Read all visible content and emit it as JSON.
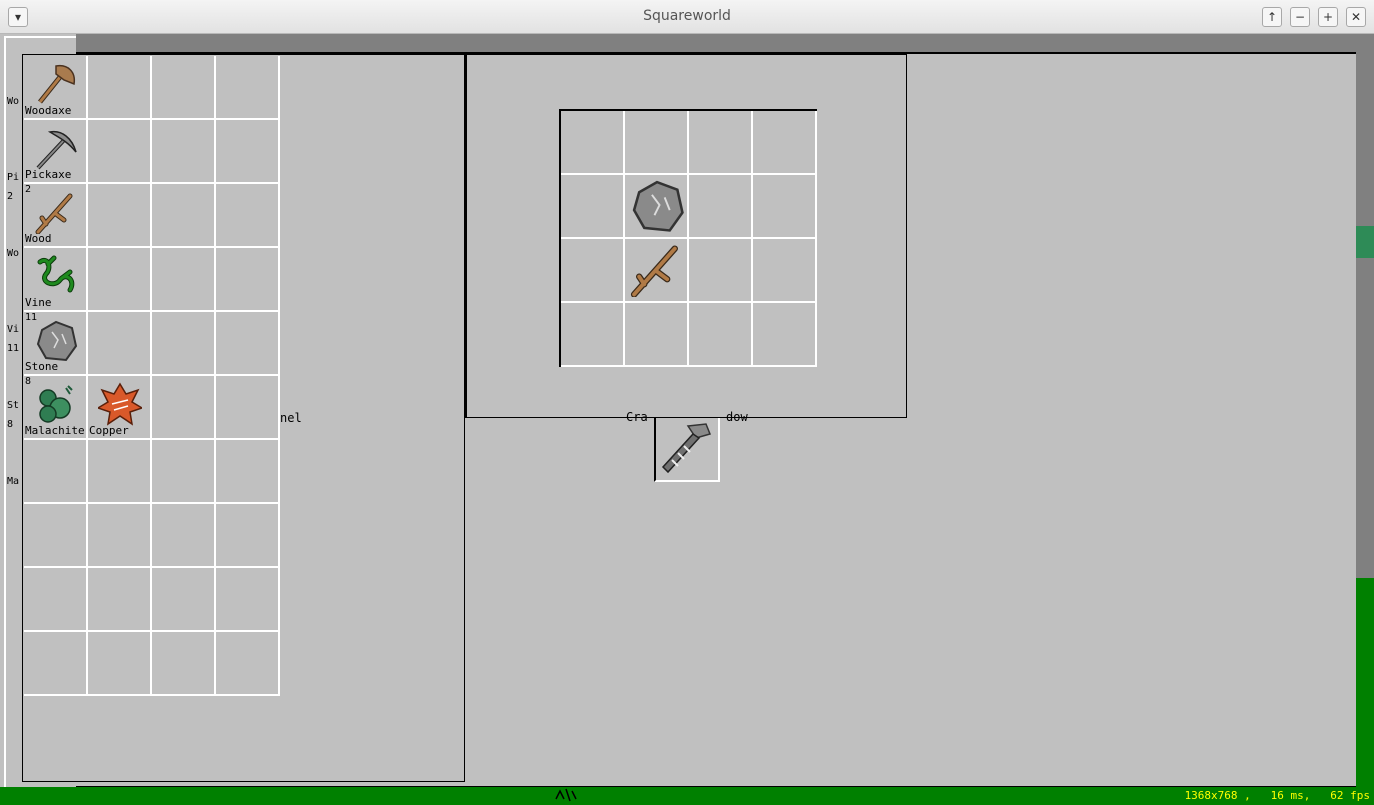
{
  "window": {
    "title": "Squareworld"
  },
  "titlebar": {
    "menu_glyph": "▾",
    "buttons": [
      "↑",
      "−",
      "+",
      "✕"
    ]
  },
  "inventory": {
    "panel_label_partial": "nel",
    "items": [
      {
        "name": "Woodaxe",
        "count": "",
        "icon": "axe-icon"
      },
      {
        "name": "Pickaxe",
        "count": "",
        "icon": "pickaxe-icon"
      },
      {
        "name": "Wood",
        "count": "2",
        "icon": "stick-icon"
      },
      {
        "name": "Vine",
        "count": "",
        "icon": "vine-icon"
      },
      {
        "name": "Stone",
        "count": "11",
        "icon": "stone-icon"
      },
      {
        "name": "Malachite",
        "count": "8",
        "icon": "malachite-icon"
      },
      {
        "name": "Copper",
        "count": "",
        "icon": "copper-icon"
      }
    ]
  },
  "crafting": {
    "window_label_partial_left": "Cra",
    "window_label_partial_right": "dow",
    "grid_items": [
      {
        "row": 1,
        "col": 1,
        "icon": "stone-icon"
      },
      {
        "row": 2,
        "col": 1,
        "icon": "stick-icon"
      }
    ],
    "result_icon": "hammer-icon"
  },
  "side_strip": {
    "labels": [
      "Wo",
      "Pi",
      "2",
      "Wo",
      "Vi",
      "11",
      "St",
      "8",
      "Ma"
    ]
  },
  "statusbar": {
    "resolution": "1368x768",
    "frame_time": "16 ms",
    "fps": "62 fps",
    "text": "1368x768 ,   16 ms,   62 fps"
  },
  "colors": {
    "panel_bg": "#c0c0c0",
    "grid_line": "#ffffff",
    "status_green": "#008000",
    "status_text": "#ffff00",
    "frame_dark": "#808080"
  }
}
